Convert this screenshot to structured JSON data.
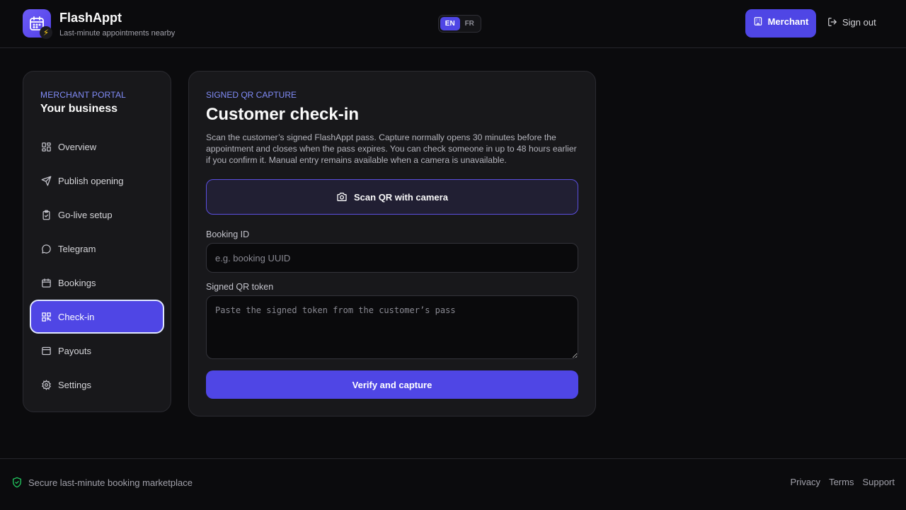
{
  "app": {
    "name": "FlashAppt",
    "tagline": "Last-minute appointments nearby"
  },
  "header": {
    "languages": [
      "EN",
      "FR"
    ],
    "active_language": "EN",
    "merchant_label": "Merchant",
    "signout_label": "Sign out"
  },
  "sidebar": {
    "eyebrow": "MERCHANT PORTAL",
    "title": "Your business",
    "items": [
      {
        "label": "Overview",
        "icon": "grid-icon"
      },
      {
        "label": "Publish opening",
        "icon": "send-icon"
      },
      {
        "label": "Go-live setup",
        "icon": "clipboard-check-icon"
      },
      {
        "label": "Telegram",
        "icon": "chat-bubble-icon"
      },
      {
        "label": "Bookings",
        "icon": "calendar-icon"
      },
      {
        "label": "Check-in",
        "icon": "qr-code-icon",
        "active": true
      },
      {
        "label": "Payouts",
        "icon": "wallet-icon"
      },
      {
        "label": "Settings",
        "icon": "gear-icon"
      }
    ]
  },
  "main": {
    "eyebrow": "SIGNED QR CAPTURE",
    "title": "Customer check-in",
    "description": "Scan the customer’s signed FlashAppt pass. Capture normally opens 30 minutes before the appointment and closes when the pass expires. You can check someone in up to 48 hours earlier if you confirm it. Manual entry remains available when a camera is unavailable.",
    "scan_label": "Scan QR with camera",
    "booking_id": {
      "label": "Booking ID",
      "placeholder": "e.g. booking UUID",
      "value": ""
    },
    "token": {
      "label": "Signed QR token",
      "placeholder": "Paste the signed token from the customer’s pass",
      "value": ""
    },
    "verify_label": "Verify and capture"
  },
  "footer": {
    "secure_text": "Secure last-minute booking marketplace",
    "links": [
      "Privacy",
      "Terms",
      "Support"
    ]
  },
  "colors": {
    "accent": "#4f46e5",
    "eyebrow": "#818cf8",
    "background": "#0b0b0d",
    "panel": "#18181b",
    "secure": "#22c55e"
  }
}
